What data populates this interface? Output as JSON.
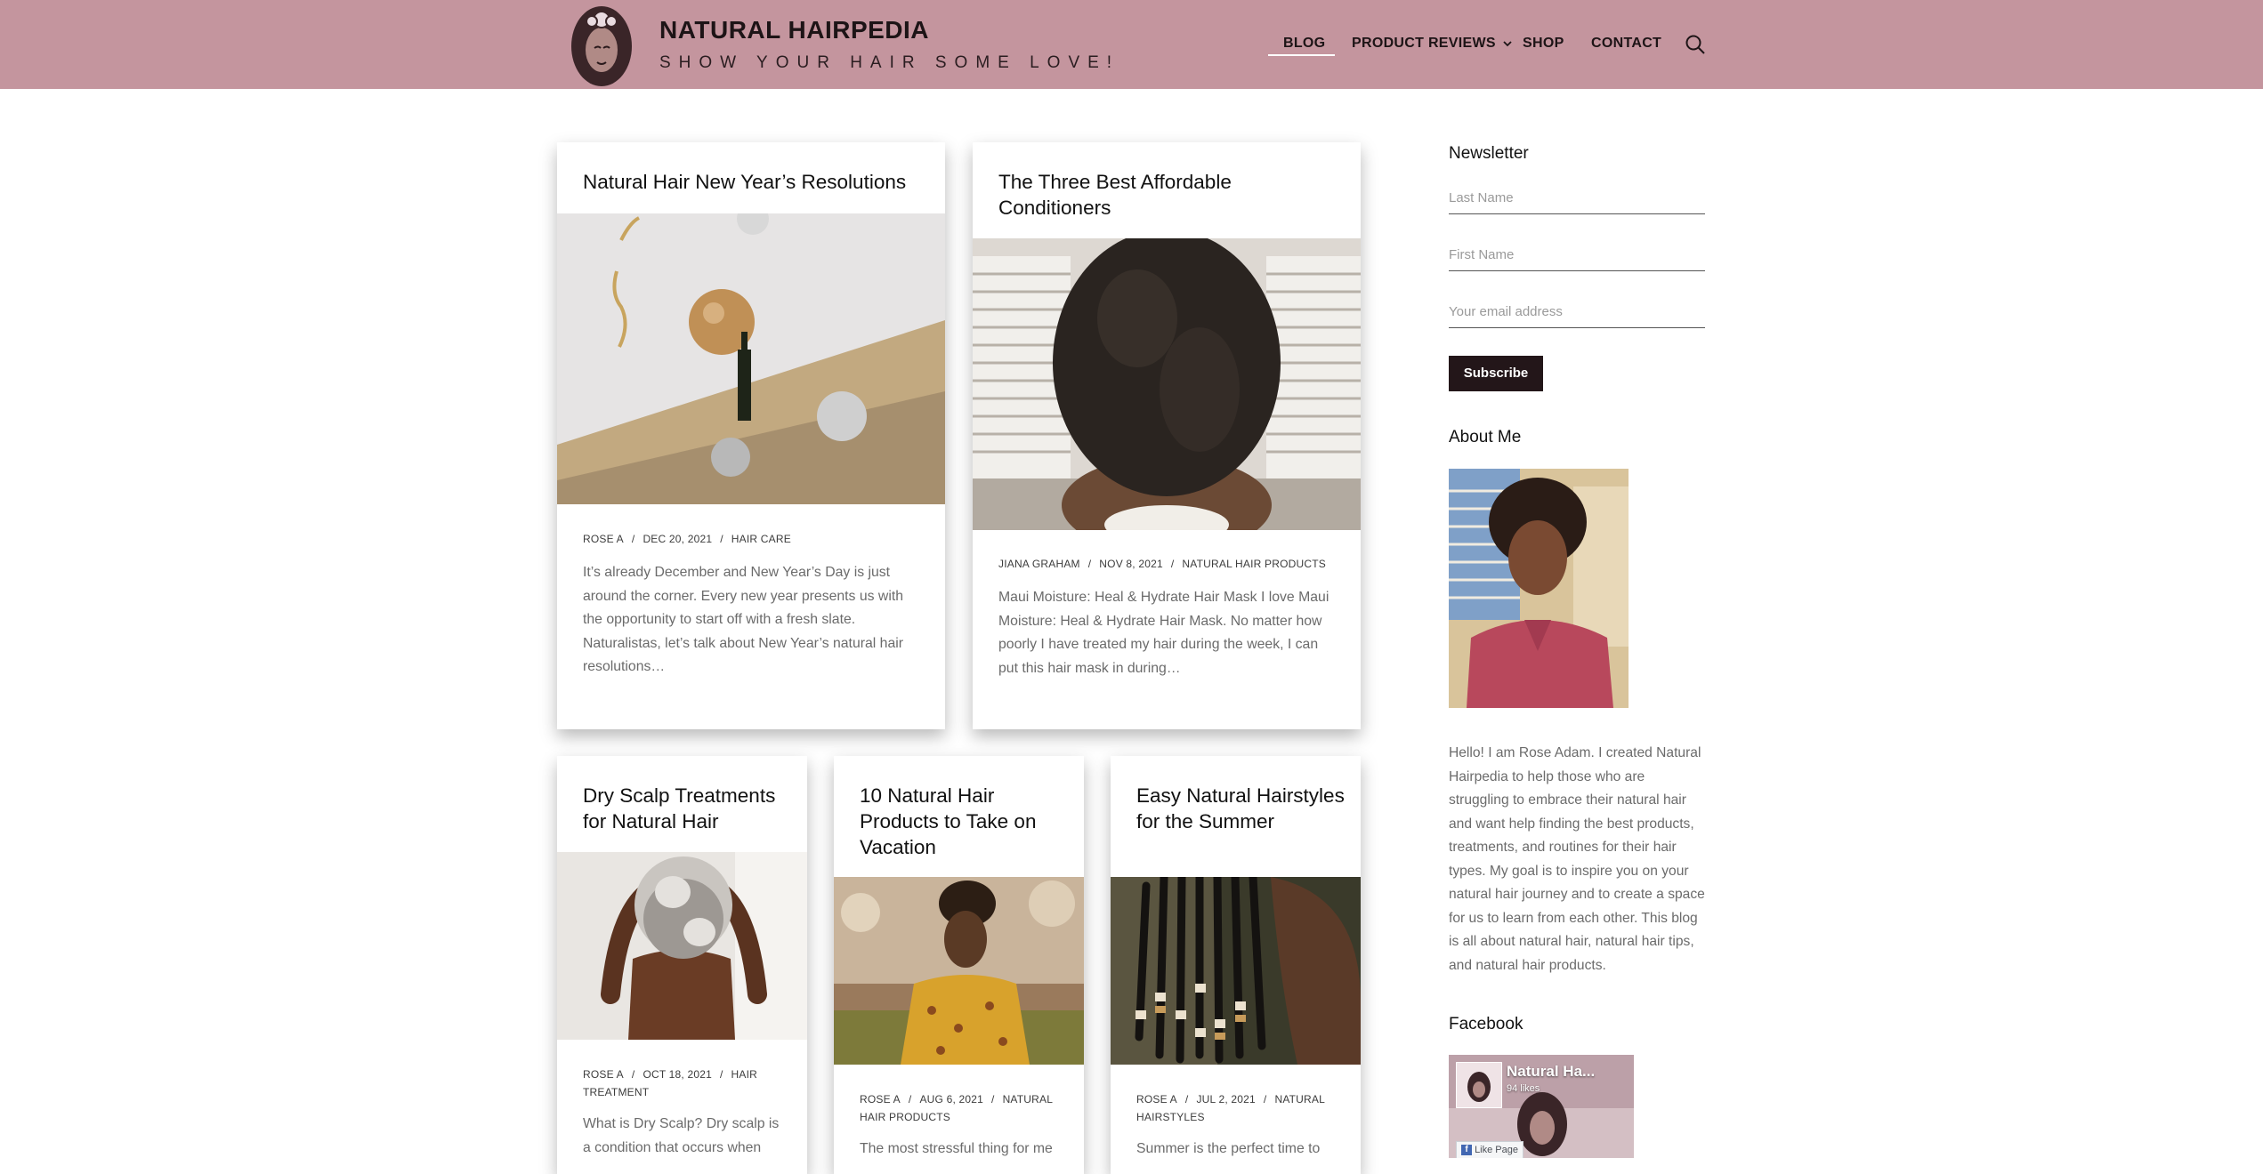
{
  "site": {
    "title": "NATURAL HAIRPEDIA",
    "tagline": "SHOW YOUR HAIR SOME LOVE!"
  },
  "nav": {
    "blog": "BLOG",
    "reviews": "PRODUCT REVIEWS",
    "shop": "SHOP",
    "contact": "CONTACT"
  },
  "posts": [
    {
      "title": "Natural Hair New Year’s Resolutions",
      "author": "ROSE A",
      "date": "DEC 20, 2021",
      "category": "HAIR CARE",
      "excerpt": "It’s already December and New Year’s Day is just around the corner. Every new year presents us with the opportunity to start off with a fresh slate. Naturalistas, let’s talk about New Year’s natural hair resolutions…"
    },
    {
      "title": "The Three Best Affordable Conditioners",
      "author": "JIANA GRAHAM",
      "date": "NOV 8, 2021",
      "category": "NATURAL HAIR PRODUCTS",
      "excerpt": "Maui Moisture: Heal & Hydrate Hair Mask I love Maui Moisture: Heal & Hydrate Hair Mask. No matter how poorly I have treated my hair during the week, I can put this hair mask in during…"
    },
    {
      "title": "Dry Scalp Treatments for Natural Hair",
      "author": "ROSE A",
      "date": "OCT 18, 2021",
      "category": "HAIR TREATMENT",
      "excerpt": "What is Dry Scalp? Dry scalp is a condition that occurs when"
    },
    {
      "title": "10 Natural Hair Products to Take on Vacation",
      "author": "ROSE A",
      "date": "AUG 6, 2021",
      "category": "NATURAL HAIR PRODUCTS",
      "excerpt": "The most stressful thing for me"
    },
    {
      "title": "Easy Natural Hairstyles for the Summer",
      "author": "ROSE A",
      "date": "JUL 2, 2021",
      "category": "NATURAL HAIRSTYLES",
      "excerpt": "Summer is the perfect time to"
    }
  ],
  "sidebar": {
    "newsletter_title": "Newsletter",
    "last_name_placeholder": "Last Name",
    "first_name_placeholder": "First Name",
    "email_placeholder": "Your email address",
    "subscribe_label": "Subscribe",
    "about_title": "About Me",
    "about_text": "Hello! I am Rose Adam. I created Natural Hairpedia to help those who are struggling to embrace their natural hair and want help finding the best products, treatments, and routines for their hair types. My goal is to inspire you on your natural hair journey and to create a space for us to learn from each other. This blog is all about natural hair, natural hair tips, and natural hair products.",
    "facebook_title": "Facebook",
    "fb_page_name": "Natural Ha...",
    "fb_likes": "94 likes",
    "fb_like_button": "Like Page"
  },
  "colors": {
    "header_bg": "#c4959e",
    "subscribe_bg": "#231619"
  }
}
